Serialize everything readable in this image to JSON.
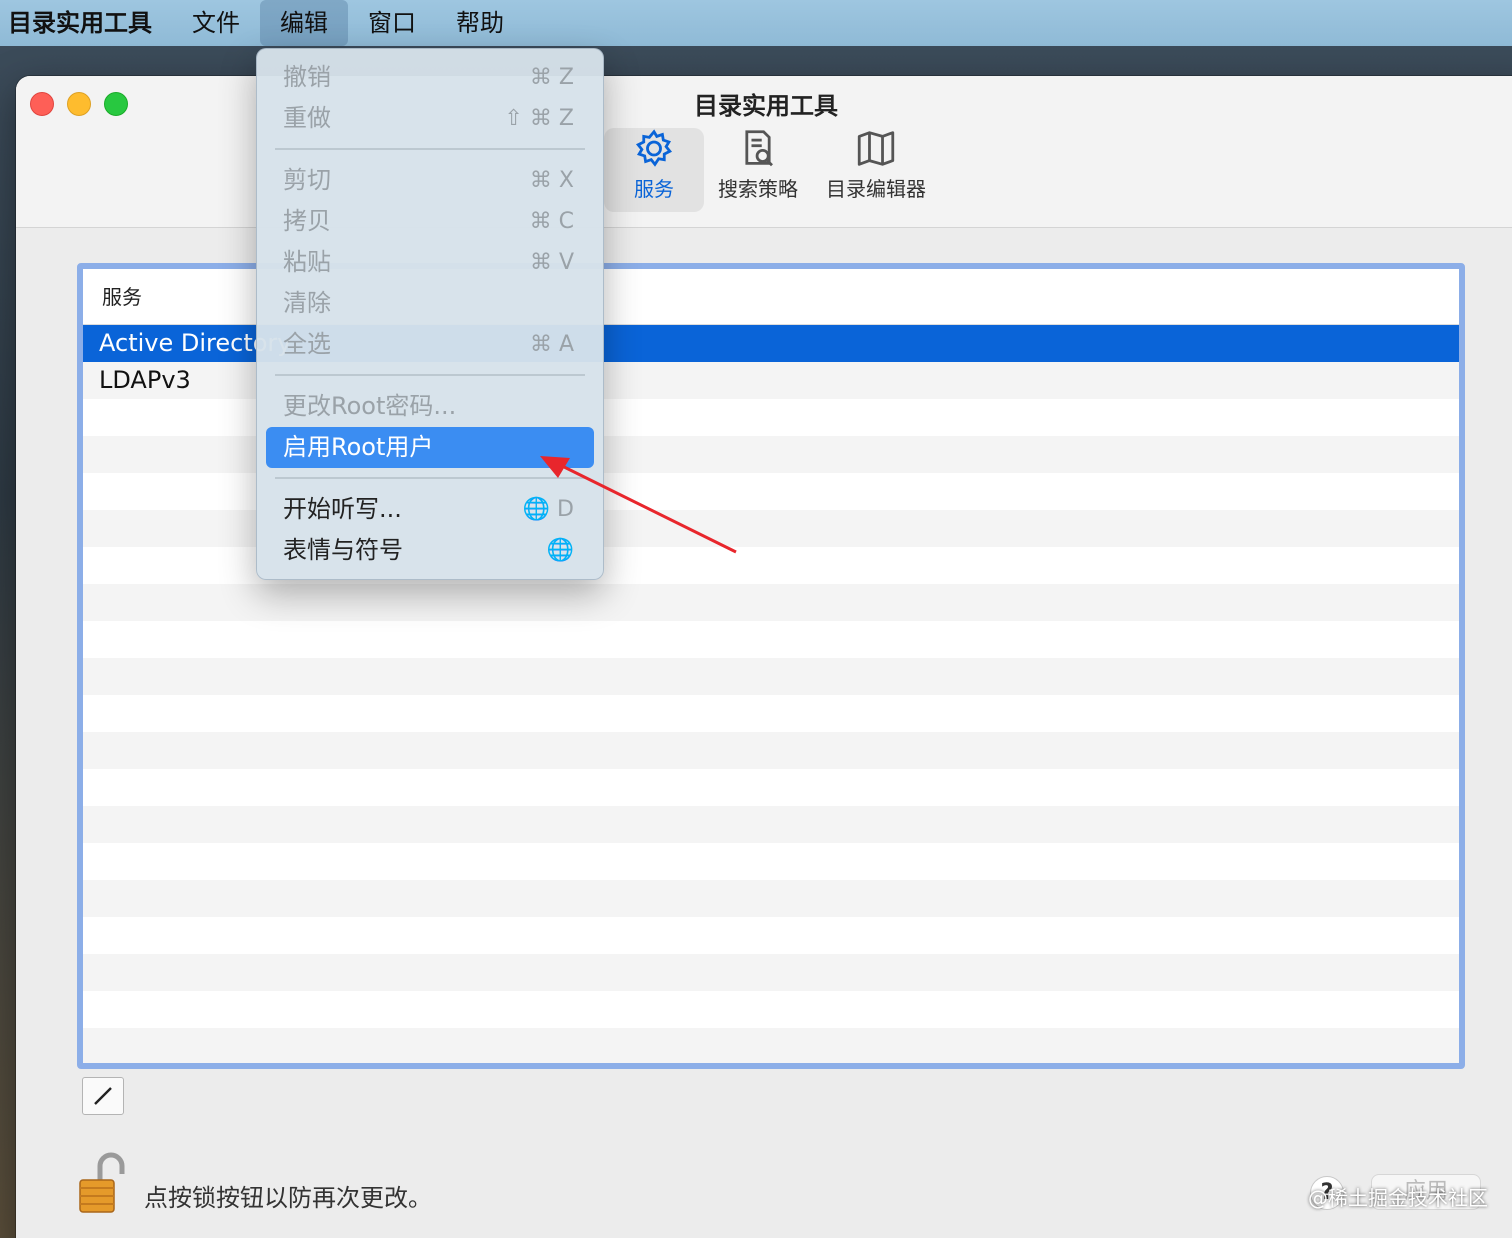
{
  "menubar": {
    "app": "目录实用工具",
    "file": "文件",
    "edit": "编辑",
    "window": "窗口",
    "help": "帮助"
  },
  "window": {
    "title": "目录实用工具",
    "toolbar": {
      "services": "服务",
      "search_policy": "搜索策略",
      "directory_editor": "目录编辑器"
    }
  },
  "table": {
    "header": "服务",
    "rows": [
      "Active Directory",
      "LDAPv3"
    ]
  },
  "footer": {
    "lock_text": "点按锁按钮以防再次更改。",
    "apply_label": "应用",
    "help_label": "?",
    "watermark": "@稀土掘金技术社区"
  },
  "edit_menu": {
    "undo": "撤销",
    "undo_sc": "⌘ Z",
    "redo": "重做",
    "redo_sc": "⇧ ⌘ Z",
    "cut": "剪切",
    "cut_sc": "⌘ X",
    "copy": "拷贝",
    "copy_sc": "⌘ C",
    "paste": "粘贴",
    "paste_sc": "⌘ V",
    "clear": "清除",
    "select_all": "全选",
    "select_all_sc": "⌘ A",
    "change_root_pwd": "更改Root密码...",
    "enable_root": "启用Root用户",
    "dictation": "开始听写...",
    "dictation_sc": "🌐 D",
    "emoji": "表情与符号",
    "emoji_sc": "🌐"
  },
  "colors": {
    "selection": "#0a64d8",
    "menu_highlight": "#3b8df2",
    "annotation_arrow": "#e8262c"
  }
}
